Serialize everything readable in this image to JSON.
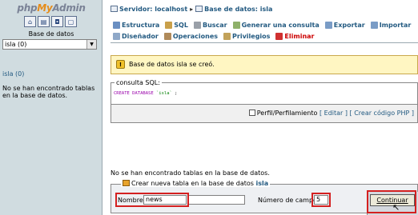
{
  "sidebar": {
    "logo_php": "php",
    "logo_my": "My",
    "logo_admin": "Admin",
    "db_label": "Base de datos",
    "db_select_value": "isla (0)",
    "db_link": "isla",
    "db_link_count": " (0)",
    "no_tables": "No se han encontrado tablas en la base de datos."
  },
  "breadcrumb": {
    "server": "Servidor: localhost",
    "separator": "▸",
    "database": "Base de datos: isla"
  },
  "tabs": {
    "row1": [
      "Estructura",
      "SQL",
      "Buscar",
      "Generar una consulta",
      "Exportar",
      "Importar"
    ],
    "row2": [
      "Diseñador",
      "Operaciones",
      "Privilegios",
      "Eliminar"
    ]
  },
  "notice": {
    "icon": "!",
    "text": "Base de datos isla se creó."
  },
  "sql": {
    "legend": "consulta SQL:",
    "keyword": "CREATE DATABASE",
    "name": "`isla`",
    "suffix": " ;",
    "profiling": "Perfil/Perfilamiento",
    "edit": "[ Editar ]",
    "create_php": "[ Crear código PHP ]"
  },
  "no_tables": "No se han encontrado tablas en la base de datos.",
  "create_table": {
    "legend_prefix": "Crear nueva tabla en la base de datos",
    "legend_db": "isla",
    "name_label": "Nombre:",
    "name_value": "news",
    "fields_label": "Número de campos:",
    "fields_value": "5",
    "continue": "Continuar"
  },
  "colors": {
    "highlight": "#d42020",
    "link": "#235a81",
    "danger": "#cc0000"
  }
}
